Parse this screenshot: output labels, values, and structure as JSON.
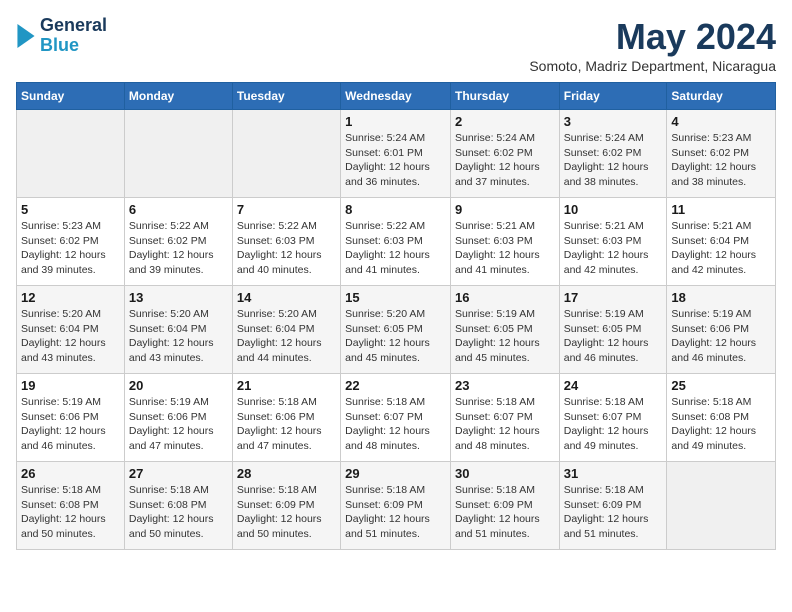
{
  "logo": {
    "line1": "General",
    "line2": "Blue"
  },
  "title": "May 2024",
  "subtitle": "Somoto, Madriz Department, Nicaragua",
  "days_header": [
    "Sunday",
    "Monday",
    "Tuesday",
    "Wednesday",
    "Thursday",
    "Friday",
    "Saturday"
  ],
  "weeks": [
    [
      {
        "day": "",
        "info": ""
      },
      {
        "day": "",
        "info": ""
      },
      {
        "day": "",
        "info": ""
      },
      {
        "day": "1",
        "info": "Sunrise: 5:24 AM\nSunset: 6:01 PM\nDaylight: 12 hours\nand 36 minutes."
      },
      {
        "day": "2",
        "info": "Sunrise: 5:24 AM\nSunset: 6:02 PM\nDaylight: 12 hours\nand 37 minutes."
      },
      {
        "day": "3",
        "info": "Sunrise: 5:24 AM\nSunset: 6:02 PM\nDaylight: 12 hours\nand 38 minutes."
      },
      {
        "day": "4",
        "info": "Sunrise: 5:23 AM\nSunset: 6:02 PM\nDaylight: 12 hours\nand 38 minutes."
      }
    ],
    [
      {
        "day": "5",
        "info": "Sunrise: 5:23 AM\nSunset: 6:02 PM\nDaylight: 12 hours\nand 39 minutes."
      },
      {
        "day": "6",
        "info": "Sunrise: 5:22 AM\nSunset: 6:02 PM\nDaylight: 12 hours\nand 39 minutes."
      },
      {
        "day": "7",
        "info": "Sunrise: 5:22 AM\nSunset: 6:03 PM\nDaylight: 12 hours\nand 40 minutes."
      },
      {
        "day": "8",
        "info": "Sunrise: 5:22 AM\nSunset: 6:03 PM\nDaylight: 12 hours\nand 41 minutes."
      },
      {
        "day": "9",
        "info": "Sunrise: 5:21 AM\nSunset: 6:03 PM\nDaylight: 12 hours\nand 41 minutes."
      },
      {
        "day": "10",
        "info": "Sunrise: 5:21 AM\nSunset: 6:03 PM\nDaylight: 12 hours\nand 42 minutes."
      },
      {
        "day": "11",
        "info": "Sunrise: 5:21 AM\nSunset: 6:04 PM\nDaylight: 12 hours\nand 42 minutes."
      }
    ],
    [
      {
        "day": "12",
        "info": "Sunrise: 5:20 AM\nSunset: 6:04 PM\nDaylight: 12 hours\nand 43 minutes."
      },
      {
        "day": "13",
        "info": "Sunrise: 5:20 AM\nSunset: 6:04 PM\nDaylight: 12 hours\nand 43 minutes."
      },
      {
        "day": "14",
        "info": "Sunrise: 5:20 AM\nSunset: 6:04 PM\nDaylight: 12 hours\nand 44 minutes."
      },
      {
        "day": "15",
        "info": "Sunrise: 5:20 AM\nSunset: 6:05 PM\nDaylight: 12 hours\nand 45 minutes."
      },
      {
        "day": "16",
        "info": "Sunrise: 5:19 AM\nSunset: 6:05 PM\nDaylight: 12 hours\nand 45 minutes."
      },
      {
        "day": "17",
        "info": "Sunrise: 5:19 AM\nSunset: 6:05 PM\nDaylight: 12 hours\nand 46 minutes."
      },
      {
        "day": "18",
        "info": "Sunrise: 5:19 AM\nSunset: 6:06 PM\nDaylight: 12 hours\nand 46 minutes."
      }
    ],
    [
      {
        "day": "19",
        "info": "Sunrise: 5:19 AM\nSunset: 6:06 PM\nDaylight: 12 hours\nand 46 minutes."
      },
      {
        "day": "20",
        "info": "Sunrise: 5:19 AM\nSunset: 6:06 PM\nDaylight: 12 hours\nand 47 minutes."
      },
      {
        "day": "21",
        "info": "Sunrise: 5:18 AM\nSunset: 6:06 PM\nDaylight: 12 hours\nand 47 minutes."
      },
      {
        "day": "22",
        "info": "Sunrise: 5:18 AM\nSunset: 6:07 PM\nDaylight: 12 hours\nand 48 minutes."
      },
      {
        "day": "23",
        "info": "Sunrise: 5:18 AM\nSunset: 6:07 PM\nDaylight: 12 hours\nand 48 minutes."
      },
      {
        "day": "24",
        "info": "Sunrise: 5:18 AM\nSunset: 6:07 PM\nDaylight: 12 hours\nand 49 minutes."
      },
      {
        "day": "25",
        "info": "Sunrise: 5:18 AM\nSunset: 6:08 PM\nDaylight: 12 hours\nand 49 minutes."
      }
    ],
    [
      {
        "day": "26",
        "info": "Sunrise: 5:18 AM\nSunset: 6:08 PM\nDaylight: 12 hours\nand 50 minutes."
      },
      {
        "day": "27",
        "info": "Sunrise: 5:18 AM\nSunset: 6:08 PM\nDaylight: 12 hours\nand 50 minutes."
      },
      {
        "day": "28",
        "info": "Sunrise: 5:18 AM\nSunset: 6:09 PM\nDaylight: 12 hours\nand 50 minutes."
      },
      {
        "day": "29",
        "info": "Sunrise: 5:18 AM\nSunset: 6:09 PM\nDaylight: 12 hours\nand 51 minutes."
      },
      {
        "day": "30",
        "info": "Sunrise: 5:18 AM\nSunset: 6:09 PM\nDaylight: 12 hours\nand 51 minutes."
      },
      {
        "day": "31",
        "info": "Sunrise: 5:18 AM\nSunset: 6:09 PM\nDaylight: 12 hours\nand 51 minutes."
      },
      {
        "day": "",
        "info": ""
      }
    ]
  ]
}
